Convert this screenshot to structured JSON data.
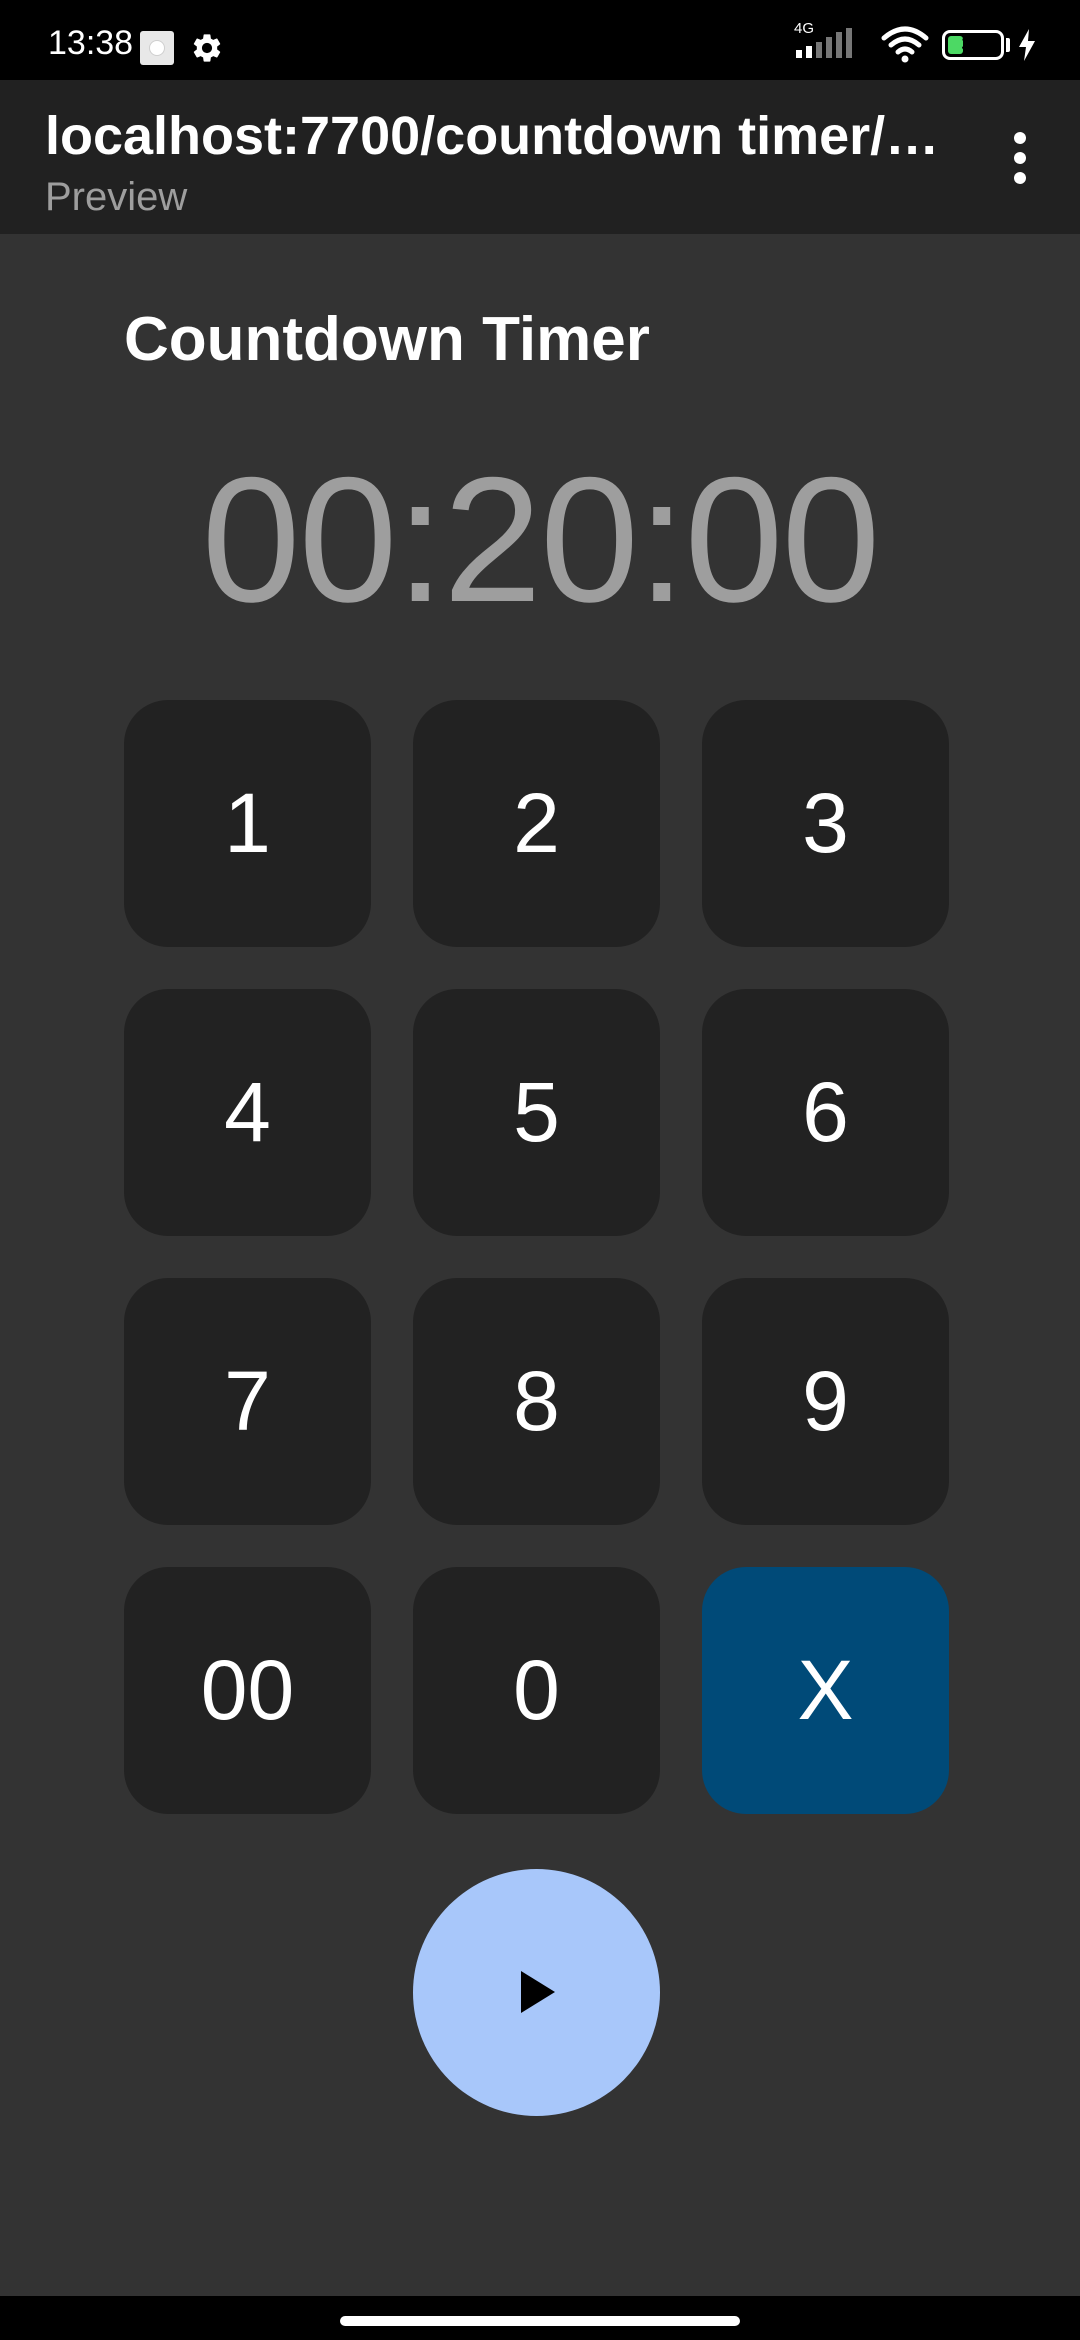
{
  "status_bar": {
    "time": "13:38",
    "network_type": "4G",
    "battery_level": "30",
    "battery_percent": 30,
    "icons": [
      "notification-icon",
      "gear-icon",
      "signal-icon",
      "wifi-icon",
      "battery-icon",
      "charging-bolt-icon"
    ]
  },
  "app_bar": {
    "title": "localhost:7700/countdown timer/c...",
    "subtitle": "Preview",
    "menu_icon": "more-vert-icon"
  },
  "page": {
    "title": "Countdown Timer",
    "timer_display": "00:20:00"
  },
  "keypad": {
    "keys": [
      "1",
      "2",
      "3",
      "4",
      "5",
      "6",
      "7",
      "8",
      "9",
      "00",
      "0",
      "X"
    ]
  },
  "controls": {
    "play_icon": "play-icon"
  },
  "colors": {
    "background": "#333333",
    "key_background": "#222222",
    "clear_key": "#004a78",
    "play_button": "#a8c7fa",
    "timer_text": "#9e9e9e",
    "app_bar": "#212121"
  }
}
